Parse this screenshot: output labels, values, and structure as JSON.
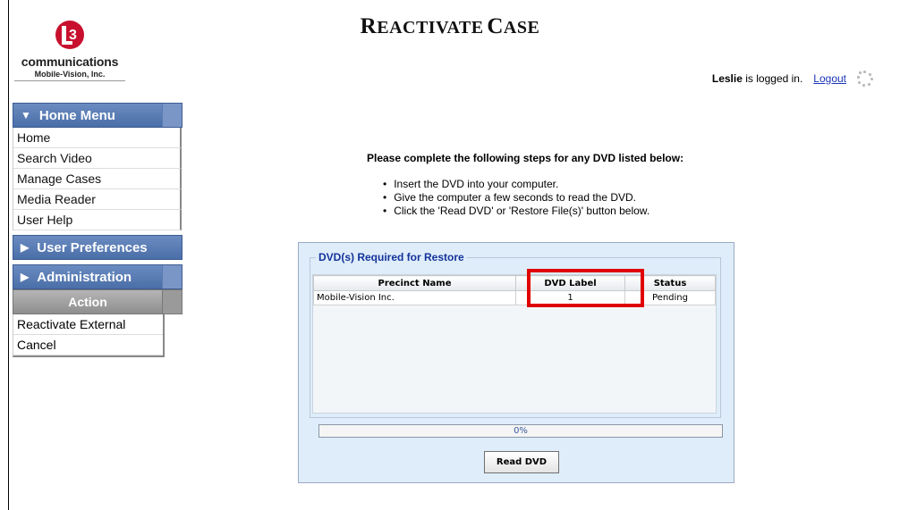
{
  "header": {
    "title_first_big": "R",
    "title_first_small": "EACTIVATE",
    "title_second_big": "C",
    "title_second_small": "ASE"
  },
  "logo": {
    "mark_text": "3",
    "brand": "communications",
    "sub": "Mobile-Vision, Inc."
  },
  "login": {
    "user": "Leslie",
    "status": "is logged in.",
    "logout_label": "Logout"
  },
  "sidebar": {
    "home_menu": {
      "label": "Home Menu",
      "items": [
        {
          "label": "Home"
        },
        {
          "label": "Search Video"
        },
        {
          "label": "Manage Cases"
        },
        {
          "label": "Media Reader"
        },
        {
          "label": "User Help"
        }
      ]
    },
    "user_preferences": "User Preferences",
    "administration": "Administration",
    "action": {
      "label": "Action",
      "items": [
        {
          "label": "Reactivate External"
        },
        {
          "label": "Cancel"
        }
      ]
    }
  },
  "instructions": {
    "lead": "Please complete the following steps for any DVD listed below:",
    "steps": [
      "Insert the DVD into your computer.",
      "Give the computer a few seconds to read the DVD.",
      "Click the 'Read DVD' or 'Restore File(s)' button below."
    ]
  },
  "restore": {
    "legend": "DVD(s) Required for Restore",
    "columns": [
      "Precinct Name",
      "DVD Label",
      "Status"
    ],
    "rows": [
      {
        "precinct": "Mobile-Vision Inc.",
        "dvd_label": "1",
        "status": "Pending"
      }
    ],
    "progress_value": 0,
    "progress_text": "0%",
    "read_button": "Read DVD"
  },
  "colors": {
    "menu_header": "#4a6ea8",
    "panel_bg": "#deedf9",
    "legend_text": "#14339c",
    "highlight_box": "#e00000",
    "link": "#1b35b5"
  }
}
